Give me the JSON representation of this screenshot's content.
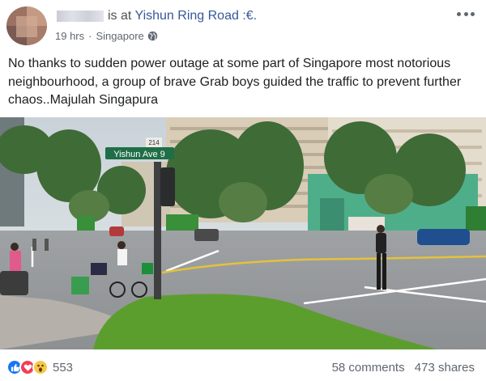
{
  "post": {
    "author_suffix": "is at",
    "location": "Yishun Ring Road :€.",
    "time": "19 hrs",
    "separator": "·",
    "place": "Singapore",
    "privacy_icon": "globe-icon",
    "more_icon": "more-options-icon",
    "text": "No thanks to sudden power outage at some part of Singapore most notorious neighbourhood, a group of brave Grab boys guided the traffic to prevent further chaos..Majulah Singapura"
  },
  "photo": {
    "street_sign": "Yishun Ave 9",
    "block_number": "214"
  },
  "footer": {
    "reaction_icons": [
      "like-icon",
      "love-icon",
      "wow-icon"
    ],
    "reaction_count": "553",
    "comments": "58 comments",
    "shares": "473 shares"
  },
  "colors": {
    "link_blue": "#365899",
    "secondary_text": "#616770",
    "like_blue": "#1877f2",
    "love_red": "#f33e58",
    "wow_yellow": "#f7c74a"
  }
}
